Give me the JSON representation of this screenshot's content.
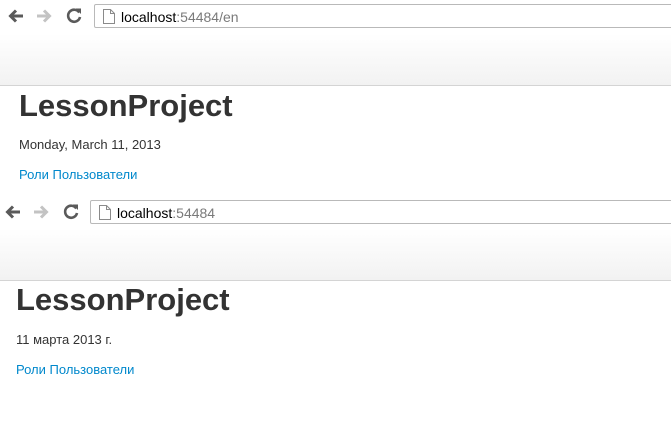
{
  "windows": [
    {
      "address_bar": {
        "host": "localhost",
        "rest": ":54484/en"
      },
      "page": {
        "title": "LessonProject",
        "date": "Monday, March 11, 2013",
        "links": [
          {
            "label": "Роли"
          },
          {
            "label": "Пользователи"
          }
        ]
      }
    },
    {
      "address_bar": {
        "host": "localhost",
        "rest": ":54484"
      },
      "page": {
        "title": "LessonProject",
        "date": "11 марта 2013 г.",
        "links": [
          {
            "label": "Роли"
          },
          {
            "label": "Пользователи"
          }
        ]
      }
    }
  ],
  "colors": {
    "link": "#0088cc",
    "text": "#333333",
    "url_secondary": "#7a7a7a",
    "navbar_border": "#d4d4d4"
  },
  "icons": [
    "back-arrow-icon",
    "forward-arrow-icon",
    "reload-icon",
    "page-icon"
  ]
}
